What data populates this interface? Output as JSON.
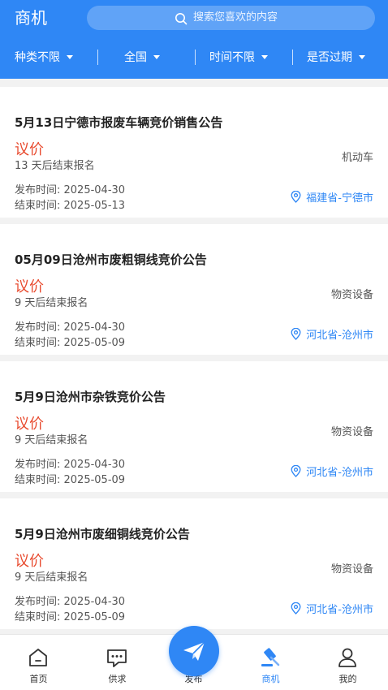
{
  "header": {
    "title": "商机",
    "search_placeholder": "搜索您喜欢的内容",
    "filters": [
      "种类不限",
      "全国",
      "时间不限",
      "是否过期"
    ]
  },
  "cards": [
    {
      "title": "5月13日宁德市报废车辆竞价销售公告",
      "type": "议价",
      "ends_in": "13 天后结束报名",
      "publish": "发布时间: 2025-04-30",
      "end": "结束时间: 2025-05-13",
      "category": "机动车",
      "location": "福建省-宁德市"
    },
    {
      "title": "05月09日沧州市废粗铜线竞价公告",
      "type": "议价",
      "ends_in": "9 天后结束报名",
      "publish": "发布时间: 2025-04-30",
      "end": "结束时间: 2025-05-09",
      "category": "物资设备",
      "location": "河北省-沧州市"
    },
    {
      "title": "5月9日沧州市杂铁竞价公告",
      "type": "议价",
      "ends_in": "9 天后结束报名",
      "publish": "发布时间: 2025-04-30",
      "end": "结束时间: 2025-05-09",
      "category": "物资设备",
      "location": "河北省-沧州市"
    },
    {
      "title": "5月9日沧州市废细铜线竞价公告",
      "type": "议价",
      "ends_in": "9 天后结束报名",
      "publish": "发布时间: 2025-04-30",
      "end": "结束时间: 2025-05-09",
      "category": "物资设备",
      "location": "河北省-沧州市"
    }
  ],
  "tabbar": {
    "home": "首页",
    "supply": "供求",
    "publish": "发布",
    "business": "商机",
    "mine": "我的"
  },
  "colors": {
    "primary": "#2f87f5",
    "price_red": "#e84b2f"
  }
}
